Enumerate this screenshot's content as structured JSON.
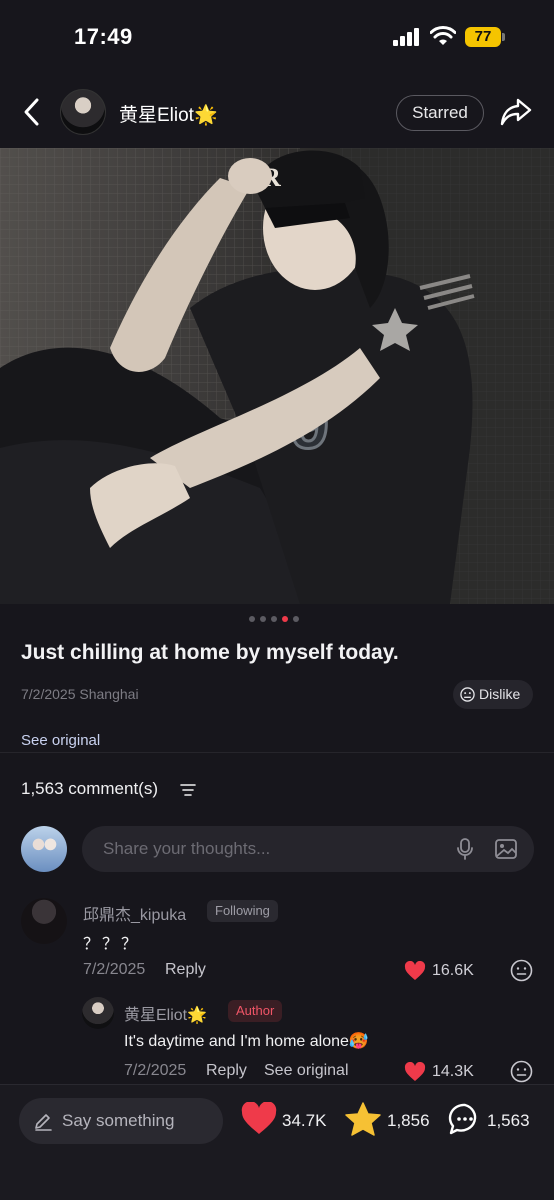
{
  "status_bar": {
    "time": "17:49",
    "battery": "77"
  },
  "header": {
    "author": "黄星Eliot🌟",
    "starred_label": "Starred"
  },
  "carousel": {
    "total": 5,
    "active_index": 3
  },
  "post": {
    "title": "Just chilling at home by myself today.",
    "meta": "7/2/2025 Shanghai",
    "dislike_label": "Dislike",
    "see_original": "See original"
  },
  "comments_section": {
    "count_label": "1,563 comment(s)",
    "input_placeholder": "Share your thoughts..."
  },
  "comments": [
    {
      "user": "邱鼎杰_kipuka",
      "badge": "Following",
      "text": "？？？",
      "date": "7/2/2025",
      "reply_label": "Reply",
      "likes": "16.6K",
      "reply": {
        "user": "黄星Eliot🌟",
        "badge": "Author",
        "text": "It's daytime and I'm home alone🥵",
        "date": "7/2/2025",
        "reply_label": "Reply",
        "see_original": "See original",
        "likes": "14.3K"
      }
    }
  ],
  "bottom_bar": {
    "say_placeholder": "Say something",
    "likes": "34.7K",
    "stars": "1,856",
    "comments": "1,563"
  },
  "colors": {
    "accent": "#ef3a4a",
    "star": "#f6c134",
    "background": "#17161c"
  },
  "icons": [
    "back-icon",
    "share-icon",
    "mic-icon",
    "image-icon",
    "heart-icon",
    "star-icon",
    "chat-icon",
    "pen-icon",
    "sort-icon",
    "emoji-icon"
  ]
}
